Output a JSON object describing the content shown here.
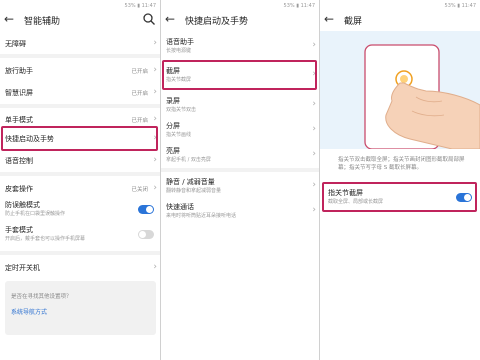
{
  "status": {
    "text": "53%  ▮  11:47"
  },
  "panel1": {
    "title": "智能辅助",
    "items": [
      {
        "label": "无障碍",
        "value": ""
      },
      {
        "label": "旅行助手",
        "value": "已开启"
      },
      {
        "label": "智慧识屏",
        "value": "已开启"
      },
      {
        "label": "单手模式",
        "value": "已开启"
      },
      {
        "label": "快捷启动及手势",
        "value": ""
      },
      {
        "label": "语音控制",
        "value": ""
      },
      {
        "label": "皮套操作",
        "value": "已关闭"
      },
      {
        "label": "防误触模式",
        "sub": "防止手机在口袋里误触操作"
      },
      {
        "label": "手套模式",
        "sub": "开启后，戴手套也可以操作手机屏幕"
      },
      {
        "label": "定时开关机",
        "value": ""
      }
    ],
    "help": {
      "question": "是否在寻找其他设置项？",
      "link": "系统导航方式"
    }
  },
  "panel2": {
    "title": "快捷启动及手势",
    "items": [
      {
        "label": "语音助手",
        "sub": "长按电源键"
      },
      {
        "label": "截屏",
        "sub": "指关节截屏"
      },
      {
        "label": "录屏",
        "sub": "双指关节双击"
      },
      {
        "label": "分屏",
        "sub": "指关节画线"
      },
      {
        "label": "亮屏",
        "sub": "拿起手机 / 双击亮屏"
      },
      {
        "label": "静音 / 减弱音量",
        "sub": "翻转静音和拿起减弱音量"
      },
      {
        "label": "快速通话",
        "sub": "来电时将听筒贴近耳朵接听电话"
      }
    ]
  },
  "panel3": {
    "title": "截屏",
    "description": "指关节双击截取全屏；指关节画封闭图形截取局部屏幕；指关节写字母 S 截取长屏幕。",
    "toggle": {
      "label": "指关节截屏",
      "sub": "截取全屏、局部或长截屏",
      "on": true
    }
  },
  "colors": {
    "highlight": "#c0245c",
    "toggle_on": "#2a74d8",
    "link": "#2a6fd0"
  }
}
